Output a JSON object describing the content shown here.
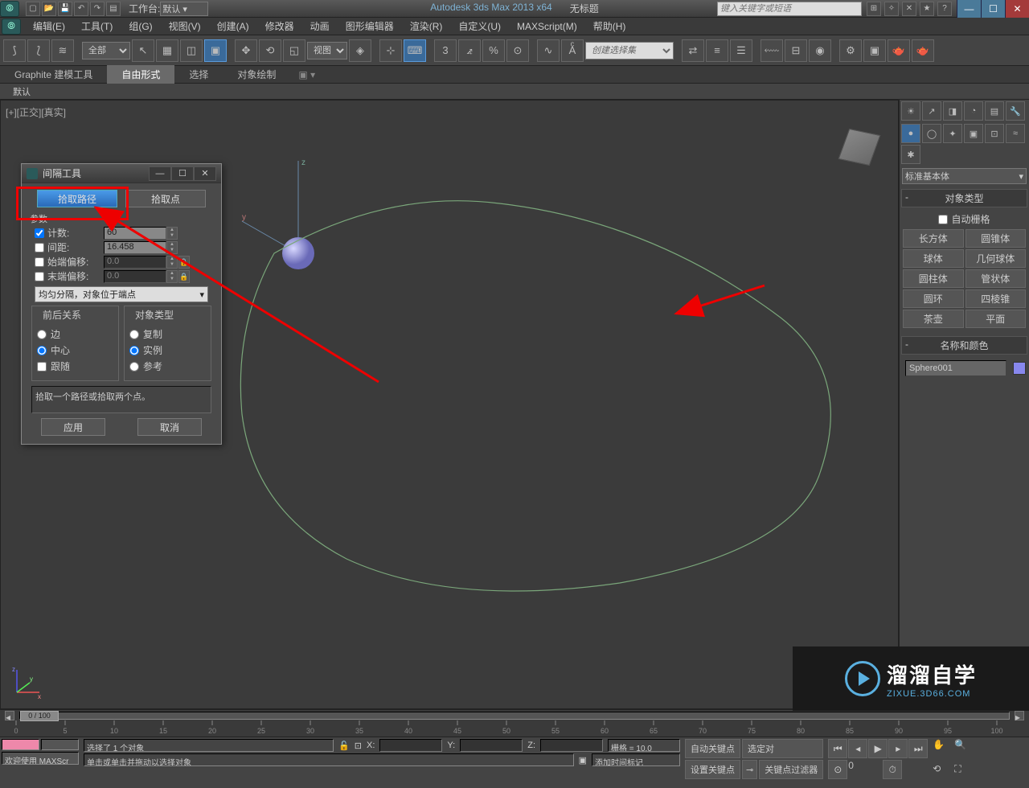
{
  "title": {
    "app": "Autodesk 3ds Max  2013 x64",
    "doc": "无标题"
  },
  "workspace": {
    "label": "工作台:",
    "value": "默认"
  },
  "search": {
    "placeholder": "键入关键字或短语"
  },
  "menu": [
    "编辑(E)",
    "工具(T)",
    "组(G)",
    "视图(V)",
    "创建(A)",
    "修改器",
    "动画",
    "图形编辑器",
    "渲染(R)",
    "自定义(U)",
    "MAXScript(M)",
    "帮助(H)"
  ],
  "toolbar": {
    "filterCombo": "全部",
    "viewCombo": "视图",
    "namedSet": "创建选择集"
  },
  "ribbon": {
    "tabs": [
      "Graphite 建模工具",
      "自由形式",
      "选择",
      "对象绘制"
    ],
    "activeIndex": 1,
    "sub": "默认"
  },
  "viewport": {
    "label": "[+][正交][真实]"
  },
  "cmdpanel": {
    "category": "标准基本体",
    "rolloutObjType": "对象类型",
    "autogrid": "自动栅格",
    "primitives": [
      [
        "长方体",
        "圆锥体"
      ],
      [
        "球体",
        "几何球体"
      ],
      [
        "圆柱体",
        "管状体"
      ],
      [
        "圆环",
        "四棱锥"
      ],
      [
        "茶壶",
        "平面"
      ]
    ],
    "rolloutName": "名称和颜色",
    "objectName": "Sphere001"
  },
  "dialog": {
    "title": "间隔工具",
    "pickPath": "拾取路径",
    "pickPoints": "拾取点",
    "paramsLabel": "参数",
    "params": {
      "count": {
        "label": "计数:",
        "value": "60",
        "checked": true
      },
      "spacing": {
        "label": "间距:",
        "value": "16.458",
        "checked": false
      },
      "startOffset": {
        "label": "始端偏移:",
        "value": "0.0",
        "checked": false
      },
      "endOffset": {
        "label": "末端偏移:",
        "value": "0.0",
        "checked": false
      }
    },
    "dropdown": "均匀分隔，对象位于端点",
    "group1": {
      "title": "前后关系",
      "opts": [
        "边",
        "中心"
      ],
      "checked": 1,
      "follow": "跟随"
    },
    "group2": {
      "title": "对象类型",
      "opts": [
        "复制",
        "实例",
        "参考"
      ],
      "checked": 1
    },
    "hint": "拾取一个路径或拾取两个点。",
    "apply": "应用",
    "cancel": "取消"
  },
  "timeline": {
    "pos": "0 / 100",
    "ticks": [
      "0",
      "5",
      "10",
      "15",
      "20",
      "25",
      "30",
      "35",
      "40",
      "45",
      "50",
      "55",
      "60",
      "65",
      "70",
      "75",
      "80",
      "85",
      "90",
      "95",
      "100"
    ]
  },
  "status": {
    "welcome": "欢迎使用  MAXScr",
    "selected": "选择了 1 个对象",
    "prompt": "单击或单击并拖动以选择对象",
    "grid": "栅格 = 10.0",
    "addTimeTag": "添加时间标记",
    "autoKey": "自动关键点",
    "setKey": "设置关键点",
    "selected2": "选定对",
    "keyFilter": "关键点过滤器"
  },
  "watermark": {
    "text": "溜溜自学",
    "url": "ZIXUE.3D66.COM"
  }
}
